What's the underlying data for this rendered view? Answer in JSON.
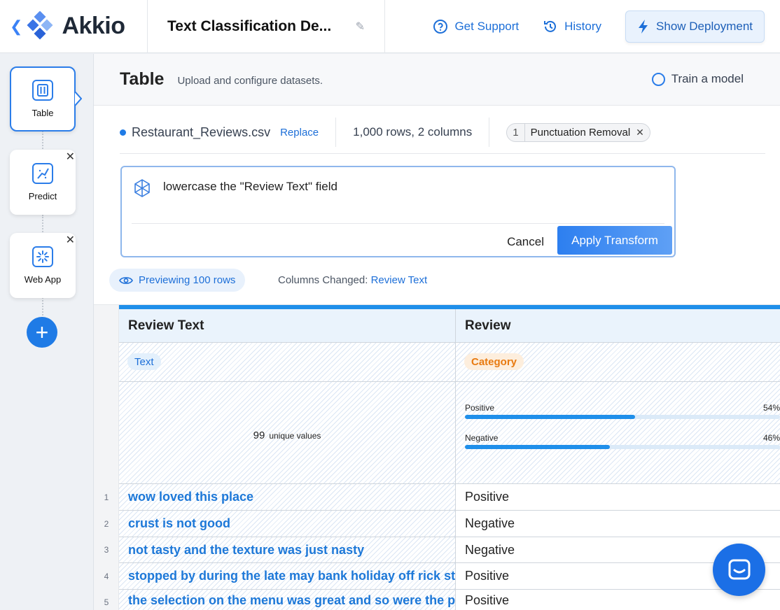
{
  "app": {
    "brand": "Akkio",
    "project_title": "Text Classification De...",
    "actions": {
      "support": "Get Support",
      "history": "History",
      "deployment": "Show Deployment"
    }
  },
  "sidebar": {
    "steps": [
      {
        "label": "Table",
        "icon": "table-icon",
        "active": true
      },
      {
        "label": "Predict",
        "icon": "predict-icon",
        "active": false
      },
      {
        "label": "Web App",
        "icon": "web-app-icon",
        "active": false
      }
    ],
    "close_glyph": "✕",
    "add_glyph": "+"
  },
  "header": {
    "title": "Table",
    "subtitle": "Upload and configure datasets.",
    "train": "Train a model"
  },
  "dataset": {
    "file_name": "Restaurant_Reviews.csv",
    "replace": "Replace",
    "summary": "1,000 rows, 2 columns",
    "transforms": [
      {
        "index": "1",
        "name": "Punctuation Removal",
        "remove": "✕"
      }
    ]
  },
  "transform": {
    "prompt": "lowercase the \"Review Text\" field",
    "cancel": "Cancel",
    "apply": "Apply Transform"
  },
  "preview": {
    "label": "Previewing 100 rows",
    "changed_label": "Columns Changed:",
    "changed_value": "Review Text"
  },
  "table": {
    "columns": [
      {
        "name": "Review Text",
        "type": "Text"
      },
      {
        "name": "Review",
        "type": "Category"
      }
    ],
    "review_text_stats": {
      "unique_count": "99",
      "unique_label": "unique values"
    },
    "review_stats": [
      {
        "label": "Positive",
        "pct_label": "54%",
        "fraction": 0.54
      },
      {
        "label": "Negative",
        "pct_label": "46%",
        "fraction": 0.46
      }
    ],
    "rows": [
      {
        "n": "1",
        "text": "wow loved this place",
        "review": "Positive"
      },
      {
        "n": "2",
        "text": "crust is not good",
        "review": "Negative"
      },
      {
        "n": "3",
        "text": "not tasty and the texture was just nasty",
        "review": "Negative"
      },
      {
        "n": "4",
        "text": "stopped by during the late may bank holiday off rick steve",
        "review": "Positive"
      },
      {
        "n": "5",
        "text": "the selection on the menu was great and so were the prices",
        "review": "Positive"
      }
    ]
  },
  "colors": {
    "accent": "#1f7be6",
    "link": "#1d6fd8",
    "category_badge": "#e87a10"
  }
}
